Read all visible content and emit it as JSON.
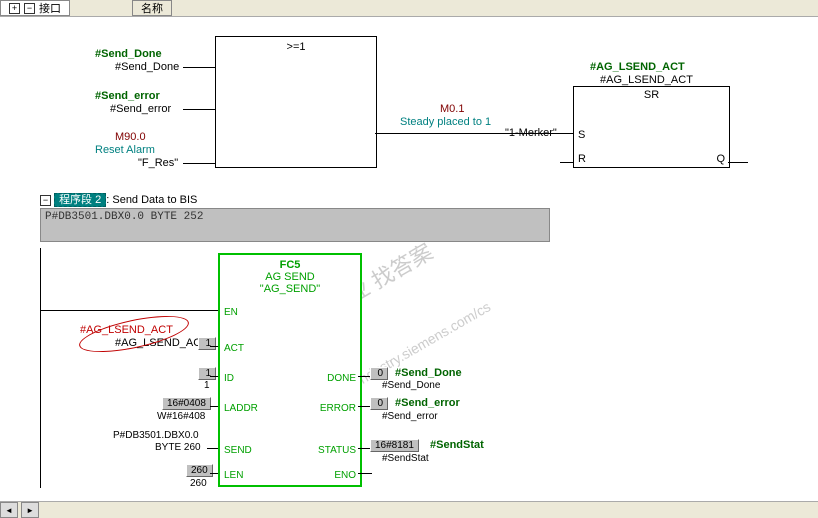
{
  "tabs": {
    "left_label": "接口",
    "right_label": "名称"
  },
  "network1": {
    "ge1_label": ">=1",
    "send_done_sym": "#Send_Done",
    "send_done_raw": "#Send_Done",
    "send_error_sym": "#Send_error",
    "send_error_raw": "#Send_error",
    "reset_sym": "M90.0",
    "reset_desc": "Reset Alarm",
    "reset_raw": "\"F_Res\"",
    "m01_addr": "M0.1",
    "m01_desc": "Steady placed to 1",
    "m01_raw": "\"1-Merker\"",
    "sr_title_sym": "#AG_LSEND_ACT",
    "sr_title_raw": "#AG_LSEND_ACT",
    "sr_type": "SR",
    "sr_s": "S",
    "sr_r": "R",
    "sr_q": "Q"
  },
  "network2": {
    "header_prefix": "程序段 2",
    "header_tail": ": Send Data to BIS",
    "grey_content": "P#DB3501.DBX0.0 BYTE 252"
  },
  "fc5": {
    "name": "FC5",
    "type": "AG SEND",
    "quoted": "\"AG_SEND\"",
    "ports": {
      "EN": "EN",
      "ACT": "ACT",
      "ID": "ID",
      "LADDR": "LADDR",
      "SEND": "SEND",
      "LEN": "LEN",
      "DONE": "DONE",
      "ERROR": "ERROR",
      "STATUS": "STATUS",
      "ENO": "ENO"
    },
    "inputs": {
      "act_sym": "#AG_LSEND_ACT",
      "act_raw": "#AG_LSEND_ACT",
      "act_val": "1",
      "id_val": "1",
      "laddr_val": "16#0408",
      "laddr_raw": "W#16#408",
      "send_p1": "P#DB3501.DBX0.0",
      "send_p2": "BYTE 260",
      "len_val": "260",
      "len_raw": "260"
    },
    "outputs": {
      "done_val": "0",
      "done_sym": "#Send_Done",
      "done_raw": "#Send_Done",
      "error_val": "0",
      "error_sym": "#Send_error",
      "error_raw": "#Send_error",
      "status_val": "16#8181",
      "status_sym": "#SendStat",
      "status_raw": "#SendStat"
    }
  },
  "watermarks": {
    "w1": "西门子工业 找答案",
    "w2": "support.industry.siemens.com/cs"
  }
}
